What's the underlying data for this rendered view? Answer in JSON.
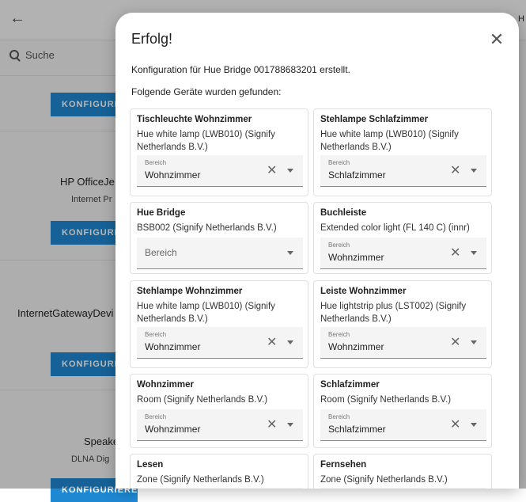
{
  "background": {
    "search_placeholder": "Suche",
    "top_right_text": "H",
    "configure_label": "KONFIGURIERE",
    "items": [
      {
        "title": "HP OfficeJe",
        "subtitle": "Internet Pr"
      },
      {
        "title": "InternetGatewayDevi",
        "subtitle": ""
      },
      {
        "title": "Speake",
        "subtitle": "DLNA Dig"
      }
    ]
  },
  "dialog": {
    "title": "Erfolg!",
    "message": "Konfiguration für Hue Bridge 001788683201 erstellt.",
    "devices_heading": "Folgende Geräte wurden gefunden:",
    "area_label": "Bereich",
    "devices": [
      {
        "name": "Tischleuchte Wohnzimmer",
        "model": "Hue white lamp (LWB010) (Signify Netherlands B.V.)",
        "area": "Wohnzimmer"
      },
      {
        "name": "Stehlampe Schlafzimmer",
        "model": "Hue white lamp (LWB010) (Signify Netherlands B.V.)",
        "area": "Schlafzimmer"
      },
      {
        "name": "Hue Bridge",
        "model": "BSB002 (Signify Netherlands B.V.)",
        "area": ""
      },
      {
        "name": "Buchleiste",
        "model": "Extended color light (FL 140 C) (innr)",
        "area": "Wohnzimmer"
      },
      {
        "name": "Stehlampe Wohnzimmer",
        "model": "Hue white lamp (LWB010) (Signify Netherlands B.V.)",
        "area": "Wohnzimmer"
      },
      {
        "name": "Leiste Wohnzimmer",
        "model": "Hue lightstrip plus (LST002) (Signify Netherlands B.V.)",
        "area": "Wohnzimmer"
      },
      {
        "name": "Wohnzimmer",
        "model": "Room (Signify Netherlands B.V.)",
        "area": "Wohnzimmer"
      },
      {
        "name": "Schlafzimmer",
        "model": "Room (Signify Netherlands B.V.)",
        "area": "Schlafzimmer"
      },
      {
        "name": "Lesen",
        "model": "Zone (Signify Netherlands B.V.)",
        "area": ""
      },
      {
        "name": "Fernsehen",
        "model": "Zone (Signify Netherlands B.V.)",
        "area": ""
      }
    ]
  },
  "colors": {
    "accent": "#1f88d3",
    "field_bg": "#f4f4f4"
  },
  "icons": {
    "back": "arrow-left-icon",
    "search": "search-icon",
    "close": "close-icon",
    "clear": "clear-x-icon",
    "dropdown": "dropdown-arrow-icon"
  }
}
